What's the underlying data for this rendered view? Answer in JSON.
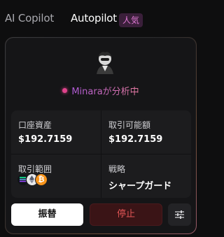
{
  "tabs": {
    "copilot_label": "AI Copilot",
    "autopilot_label": "Autopilot",
    "badge": "人気"
  },
  "status": {
    "text": "Minaraが分析中"
  },
  "stats": {
    "account_assets_label": "口座資産",
    "account_assets_value": "$192.7159",
    "tradable_label": "取引可能額",
    "tradable_value": "$192.7159",
    "range_label": "取引範囲",
    "range_coins": [
      "sol-coin-icon",
      "eth-coin-icon",
      "btc-coin-icon"
    ],
    "strategy_label": "戦略",
    "strategy_value": "シャープガード"
  },
  "buttons": {
    "transfer": "振替",
    "stop": "停止",
    "settings_icon": "sliders-icon"
  },
  "colors": {
    "status_dot": "#e0438c",
    "stop_text": "#e25555",
    "badge_text": "#e27ad6"
  }
}
